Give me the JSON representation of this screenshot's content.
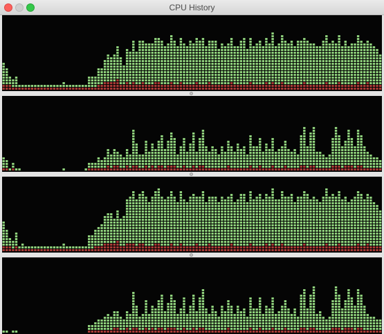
{
  "window": {
    "title": "CPU History"
  },
  "icons": {
    "close": "close-button",
    "minimize": "minimize-button",
    "zoom": "zoom-button",
    "divider": "split-handle-icon"
  },
  "colors": {
    "background": "#050505",
    "user": "#8fd17c",
    "system": "#a93a36",
    "titlebar": "#e0e0e0"
  },
  "chart_data": [
    {
      "type": "bar",
      "title": "",
      "series": [
        {
          "name": "",
          "values": [
            0.28,
            0.21,
            0.1,
            0.12,
            0.15,
            0.05,
            0.03,
            0.03,
            0.02,
            0.03,
            0.04,
            0.02,
            0.03,
            0.02,
            0.02,
            0.02,
            0.02,
            0.02,
            0.03,
            0.07,
            0.03,
            0.04,
            0.03,
            0.02,
            0.04,
            0.02,
            0.03,
            0.16,
            0.14,
            0.16,
            0.24,
            0.22,
            0.29,
            0.38,
            0.35,
            0.36,
            0.46,
            0.38,
            0.27,
            0.43,
            0.46,
            0.56,
            0.45,
            0.58,
            0.57,
            0.55,
            0.57,
            0.56,
            0.61,
            0.6,
            0.58,
            0.52,
            0.55,
            0.63,
            0.58,
            0.52,
            0.61,
            0.55,
            0.52,
            0.59,
            0.57,
            0.58,
            0.6,
            0.62,
            0.51,
            0.55,
            0.59,
            0.58,
            0.48,
            0.57,
            0.51,
            0.55,
            0.59,
            0.5,
            0.52,
            0.58,
            0.62,
            0.48,
            0.61,
            0.52,
            0.56,
            0.58,
            0.53,
            0.6,
            0.56,
            0.66,
            0.52,
            0.55,
            0.62,
            0.59,
            0.57,
            0.61,
            0.51,
            0.58,
            0.59,
            0.6,
            0.61,
            0.54,
            0.57,
            0.53,
            0.52,
            0.59,
            0.63,
            0.55,
            0.6,
            0.57,
            0.62,
            0.53,
            0.58,
            0.51,
            0.55,
            0.57,
            0.62,
            0.59,
            0.54,
            0.56,
            0.57,
            0.5,
            0.47,
            0.4
          ]
        },
        {
          "name": "",
          "values": [
            0.08,
            0.07,
            0.06,
            0.05,
            0.05,
            0.03,
            0.02,
            0.02,
            0.02,
            0.02,
            0.02,
            0.02,
            0.02,
            0.02,
            0.02,
            0.02,
            0.02,
            0.02,
            0.02,
            0.03,
            0.02,
            0.02,
            0.02,
            0.02,
            0.02,
            0.02,
            0.02,
            0.04,
            0.05,
            0.05,
            0.06,
            0.08,
            0.1,
            0.12,
            0.11,
            0.1,
            0.13,
            0.09,
            0.08,
            0.1,
            0.09,
            0.11,
            0.08,
            0.09,
            0.1,
            0.08,
            0.09,
            0.08,
            0.1,
            0.11,
            0.09,
            0.08,
            0.09,
            0.1,
            0.09,
            0.08,
            0.1,
            0.08,
            0.09,
            0.08,
            0.09,
            0.1,
            0.08,
            0.09,
            0.08,
            0.1,
            0.09,
            0.08,
            0.07,
            0.09,
            0.08,
            0.09,
            0.1,
            0.08,
            0.09,
            0.08,
            0.09,
            0.08,
            0.1,
            0.09,
            0.08,
            0.09,
            0.08,
            0.1,
            0.09,
            0.1,
            0.08,
            0.09,
            0.12,
            0.09,
            0.08,
            0.09,
            0.08,
            0.09,
            0.08,
            0.1,
            0.09,
            0.08,
            0.09,
            0.08,
            0.09,
            0.08,
            0.1,
            0.09,
            0.08,
            0.09,
            0.1,
            0.08,
            0.09,
            0.08,
            0.09,
            0.08,
            0.1,
            0.09,
            0.08,
            0.12,
            0.09,
            0.08,
            0.09,
            0.08
          ]
        }
      ]
    },
    {
      "type": "bar",
      "title": "",
      "series": [
        {
          "name": "",
          "values": [
            0.13,
            0.1,
            0.02,
            0.08,
            0.02,
            0.02,
            0.0,
            0.0,
            0.0,
            0.0,
            0.0,
            0.0,
            0.0,
            0.0,
            0.0,
            0.0,
            0.0,
            0.0,
            0.0,
            0.03,
            0.0,
            0.0,
            0.0,
            0.0,
            0.0,
            0.0,
            0.02,
            0.08,
            0.07,
            0.08,
            0.14,
            0.12,
            0.16,
            0.21,
            0.18,
            0.22,
            0.2,
            0.18,
            0.13,
            0.23,
            0.19,
            0.47,
            0.28,
            0.19,
            0.2,
            0.35,
            0.22,
            0.29,
            0.26,
            0.35,
            0.41,
            0.25,
            0.33,
            0.43,
            0.37,
            0.2,
            0.29,
            0.38,
            0.21,
            0.32,
            0.43,
            0.24,
            0.38,
            0.49,
            0.28,
            0.22,
            0.31,
            0.25,
            0.19,
            0.31,
            0.24,
            0.35,
            0.3,
            0.21,
            0.33,
            0.25,
            0.28,
            0.17,
            0.4,
            0.28,
            0.3,
            0.37,
            0.22,
            0.32,
            0.27,
            0.38,
            0.23,
            0.25,
            0.3,
            0.34,
            0.26,
            0.22,
            0.27,
            0.18,
            0.42,
            0.51,
            0.28,
            0.44,
            0.53,
            0.22,
            0.24,
            0.17,
            0.14,
            0.19,
            0.37,
            0.52,
            0.42,
            0.28,
            0.34,
            0.49,
            0.38,
            0.31,
            0.48,
            0.41,
            0.3,
            0.21,
            0.18,
            0.16,
            0.14,
            0.12
          ]
        },
        {
          "name": "",
          "values": [
            0.03,
            0.03,
            0.01,
            0.02,
            0.01,
            0.01,
            0.0,
            0.0,
            0.0,
            0.0,
            0.0,
            0.0,
            0.0,
            0.0,
            0.0,
            0.0,
            0.0,
            0.0,
            0.0,
            0.01,
            0.0,
            0.0,
            0.0,
            0.0,
            0.0,
            0.0,
            0.01,
            0.02,
            0.02,
            0.03,
            0.04,
            0.05,
            0.05,
            0.06,
            0.05,
            0.07,
            0.06,
            0.05,
            0.03,
            0.07,
            0.05,
            0.09,
            0.06,
            0.05,
            0.04,
            0.07,
            0.05,
            0.06,
            0.04,
            0.06,
            0.07,
            0.05,
            0.06,
            0.07,
            0.06,
            0.04,
            0.05,
            0.06,
            0.04,
            0.05,
            0.06,
            0.04,
            0.06,
            0.07,
            0.05,
            0.04,
            0.05,
            0.04,
            0.03,
            0.05,
            0.04,
            0.06,
            0.05,
            0.04,
            0.05,
            0.04,
            0.05,
            0.03,
            0.06,
            0.05,
            0.05,
            0.06,
            0.04,
            0.05,
            0.04,
            0.06,
            0.04,
            0.04,
            0.05,
            0.06,
            0.04,
            0.04,
            0.05,
            0.03,
            0.06,
            0.07,
            0.05,
            0.06,
            0.07,
            0.04,
            0.04,
            0.03,
            0.03,
            0.04,
            0.06,
            0.07,
            0.06,
            0.05,
            0.06,
            0.07,
            0.06,
            0.05,
            0.07,
            0.06,
            0.05,
            0.04,
            0.04,
            0.03,
            0.03,
            0.03
          ]
        }
      ]
    },
    {
      "type": "bar",
      "title": "",
      "series": [
        {
          "name": "",
          "values": [
            0.32,
            0.22,
            0.11,
            0.12,
            0.18,
            0.05,
            0.08,
            0.03,
            0.02,
            0.03,
            0.04,
            0.02,
            0.03,
            0.02,
            0.03,
            0.03,
            0.02,
            0.03,
            0.04,
            0.09,
            0.04,
            0.05,
            0.03,
            0.03,
            0.05,
            0.02,
            0.04,
            0.19,
            0.17,
            0.24,
            0.26,
            0.31,
            0.36,
            0.4,
            0.39,
            0.33,
            0.41,
            0.36,
            0.4,
            0.58,
            0.63,
            0.72,
            0.62,
            0.66,
            0.7,
            0.67,
            0.61,
            0.65,
            0.71,
            0.74,
            0.68,
            0.62,
            0.66,
            0.7,
            0.65,
            0.6,
            0.69,
            0.64,
            0.6,
            0.67,
            0.71,
            0.63,
            0.68,
            0.74,
            0.61,
            0.64,
            0.67,
            0.66,
            0.58,
            0.65,
            0.62,
            0.68,
            0.66,
            0.6,
            0.63,
            0.69,
            0.72,
            0.61,
            0.7,
            0.64,
            0.66,
            0.69,
            0.63,
            0.68,
            0.66,
            0.75,
            0.62,
            0.64,
            0.71,
            0.68,
            0.65,
            0.7,
            0.61,
            0.67,
            0.68,
            0.72,
            0.7,
            0.63,
            0.66,
            0.62,
            0.61,
            0.68,
            0.73,
            0.65,
            0.7,
            0.66,
            0.71,
            0.62,
            0.67,
            0.6,
            0.64,
            0.67,
            0.72,
            0.69,
            0.63,
            0.65,
            0.66,
            0.59,
            0.56,
            0.48
          ]
        },
        {
          "name": "",
          "values": [
            0.09,
            0.08,
            0.06,
            0.05,
            0.06,
            0.03,
            0.03,
            0.02,
            0.02,
            0.02,
            0.02,
            0.02,
            0.02,
            0.02,
            0.02,
            0.02,
            0.02,
            0.02,
            0.02,
            0.03,
            0.02,
            0.02,
            0.02,
            0.02,
            0.02,
            0.02,
            0.02,
            0.05,
            0.05,
            0.06,
            0.07,
            0.09,
            0.1,
            0.12,
            0.11,
            0.1,
            0.13,
            0.09,
            0.09,
            0.11,
            0.1,
            0.12,
            0.09,
            0.1,
            0.1,
            0.09,
            0.09,
            0.09,
            0.1,
            0.11,
            0.09,
            0.08,
            0.09,
            0.1,
            0.09,
            0.08,
            0.1,
            0.09,
            0.09,
            0.09,
            0.09,
            0.1,
            0.09,
            0.09,
            0.08,
            0.1,
            0.09,
            0.08,
            0.08,
            0.09,
            0.08,
            0.09,
            0.1,
            0.08,
            0.09,
            0.08,
            0.09,
            0.08,
            0.1,
            0.09,
            0.08,
            0.09,
            0.08,
            0.1,
            0.09,
            0.1,
            0.08,
            0.09,
            0.12,
            0.09,
            0.08,
            0.09,
            0.08,
            0.09,
            0.08,
            0.1,
            0.09,
            0.08,
            0.09,
            0.08,
            0.09,
            0.08,
            0.1,
            0.09,
            0.08,
            0.09,
            0.1,
            0.08,
            0.09,
            0.08,
            0.09,
            0.08,
            0.1,
            0.09,
            0.08,
            0.12,
            0.09,
            0.08,
            0.09,
            0.08
          ]
        }
      ]
    },
    {
      "type": "bar",
      "title": "",
      "series": [
        {
          "name": "",
          "values": [
            0.02,
            0.02,
            0.01,
            0.02,
            0.02,
            0.01,
            0.01,
            0.01,
            0.01,
            0.01,
            0.01,
            0.01,
            0.01,
            0.01,
            0.01,
            0.01,
            0.01,
            0.01,
            0.01,
            0.01,
            0.01,
            0.01,
            0.01,
            0.01,
            0.01,
            0.01,
            0.01,
            0.09,
            0.08,
            0.1,
            0.16,
            0.14,
            0.17,
            0.21,
            0.19,
            0.24,
            0.22,
            0.2,
            0.15,
            0.24,
            0.21,
            0.47,
            0.3,
            0.2,
            0.22,
            0.36,
            0.24,
            0.3,
            0.28,
            0.36,
            0.43,
            0.27,
            0.35,
            0.44,
            0.38,
            0.21,
            0.3,
            0.39,
            0.22,
            0.33,
            0.44,
            0.26,
            0.39,
            0.5,
            0.29,
            0.23,
            0.33,
            0.27,
            0.2,
            0.33,
            0.26,
            0.37,
            0.32,
            0.22,
            0.34,
            0.26,
            0.29,
            0.18,
            0.41,
            0.29,
            0.31,
            0.39,
            0.23,
            0.34,
            0.28,
            0.4,
            0.24,
            0.27,
            0.32,
            0.36,
            0.28,
            0.23,
            0.28,
            0.19,
            0.44,
            0.53,
            0.3,
            0.46,
            0.55,
            0.23,
            0.25,
            0.18,
            0.15,
            0.2,
            0.38,
            0.54,
            0.44,
            0.3,
            0.36,
            0.51,
            0.4,
            0.33,
            0.5,
            0.43,
            0.32,
            0.22,
            0.19,
            0.17,
            0.15,
            0.13
          ]
        },
        {
          "name": "",
          "values": [
            0.01,
            0.01,
            0.0,
            0.01,
            0.01,
            0.0,
            0.0,
            0.0,
            0.0,
            0.0,
            0.0,
            0.0,
            0.0,
            0.0,
            0.0,
            0.0,
            0.0,
            0.0,
            0.0,
            0.0,
            0.0,
            0.0,
            0.0,
            0.0,
            0.0,
            0.0,
            0.0,
            0.02,
            0.02,
            0.03,
            0.04,
            0.04,
            0.05,
            0.05,
            0.05,
            0.06,
            0.06,
            0.05,
            0.04,
            0.06,
            0.05,
            0.08,
            0.06,
            0.05,
            0.05,
            0.07,
            0.05,
            0.06,
            0.05,
            0.06,
            0.07,
            0.05,
            0.06,
            0.07,
            0.06,
            0.04,
            0.05,
            0.06,
            0.04,
            0.05,
            0.06,
            0.04,
            0.06,
            0.07,
            0.05,
            0.04,
            0.05,
            0.04,
            0.03,
            0.05,
            0.04,
            0.06,
            0.05,
            0.04,
            0.05,
            0.04,
            0.05,
            0.03,
            0.06,
            0.05,
            0.05,
            0.06,
            0.04,
            0.05,
            0.04,
            0.06,
            0.04,
            0.04,
            0.05,
            0.06,
            0.04,
            0.04,
            0.05,
            0.03,
            0.06,
            0.07,
            0.05,
            0.06,
            0.07,
            0.04,
            0.04,
            0.03,
            0.03,
            0.04,
            0.06,
            0.07,
            0.06,
            0.05,
            0.06,
            0.07,
            0.06,
            0.05,
            0.07,
            0.06,
            0.05,
            0.04,
            0.04,
            0.03,
            0.03,
            0.03
          ]
        }
      ]
    }
  ]
}
